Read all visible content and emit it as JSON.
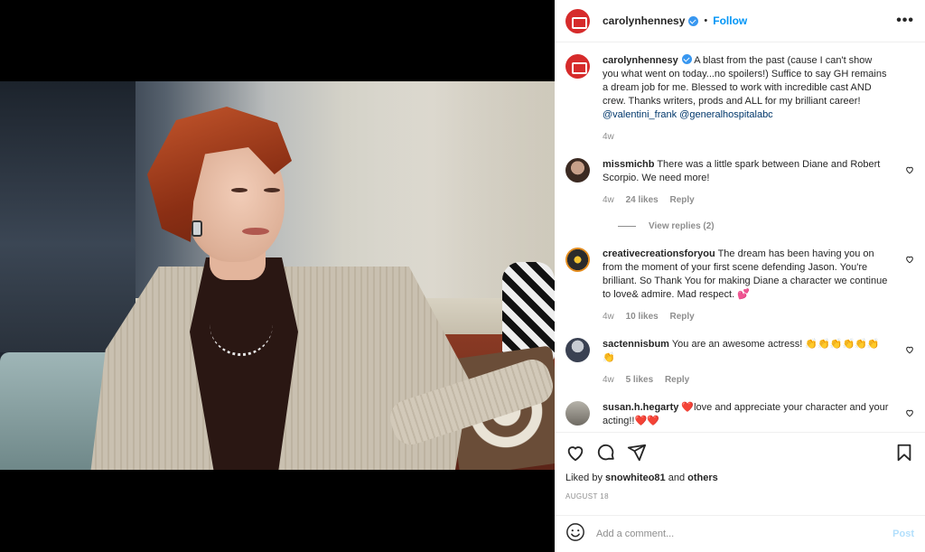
{
  "header": {
    "username": "carolynhennesy",
    "separator": "•",
    "follow_label": "Follow",
    "more_label": "•••"
  },
  "caption": {
    "username": "carolynhennesy",
    "text": "A blast from the past (cause I can't show you what went on today...no spoilers!) Suffice to say GH remains a dream job for me. Blessed to work with incredible cast AND crew. Thanks writers, prods and ALL for my brilliant career!",
    "mention_1": "@valentini_frank",
    "mention_2": "@generalhospitalabc",
    "time": "4w"
  },
  "comments": [
    {
      "username": "missmichb",
      "text": "There was a little spark between Diane and Robert Scorpio. We need more!",
      "time": "4w",
      "likes": "24 likes",
      "reply": "Reply",
      "view_replies": "View replies (2)"
    },
    {
      "username": "creativecreationsforyou",
      "text": "The dream has been having you on from the moment of your first scene defending Jason. You're brilliant. So Thank You for making Diane a character we continue to love& admire. Mad respect. 💕",
      "time": "4w",
      "likes": "10 likes",
      "reply": "Reply"
    },
    {
      "username": "sactennisbum",
      "text": "You are an awesome actress! 👏👏👏👏👏👏👏",
      "time": "4w",
      "likes": "5 likes",
      "reply": "Reply"
    },
    {
      "username": "susan.h.hegarty",
      "text": "❤️love and appreciate your character and your acting!!❤️❤️"
    }
  ],
  "liked_by": {
    "prefix": "Liked by",
    "user": "snowhiteo81",
    "and": "and",
    "others": "others"
  },
  "date": "AUGUST 18",
  "add_comment": {
    "placeholder": "Add a comment...",
    "post_label": "Post"
  },
  "colors": {
    "link": "#0095f6",
    "mention": "#00376b",
    "avatar_brand": "#d62b2b",
    "muted": "#8e8e8e"
  }
}
